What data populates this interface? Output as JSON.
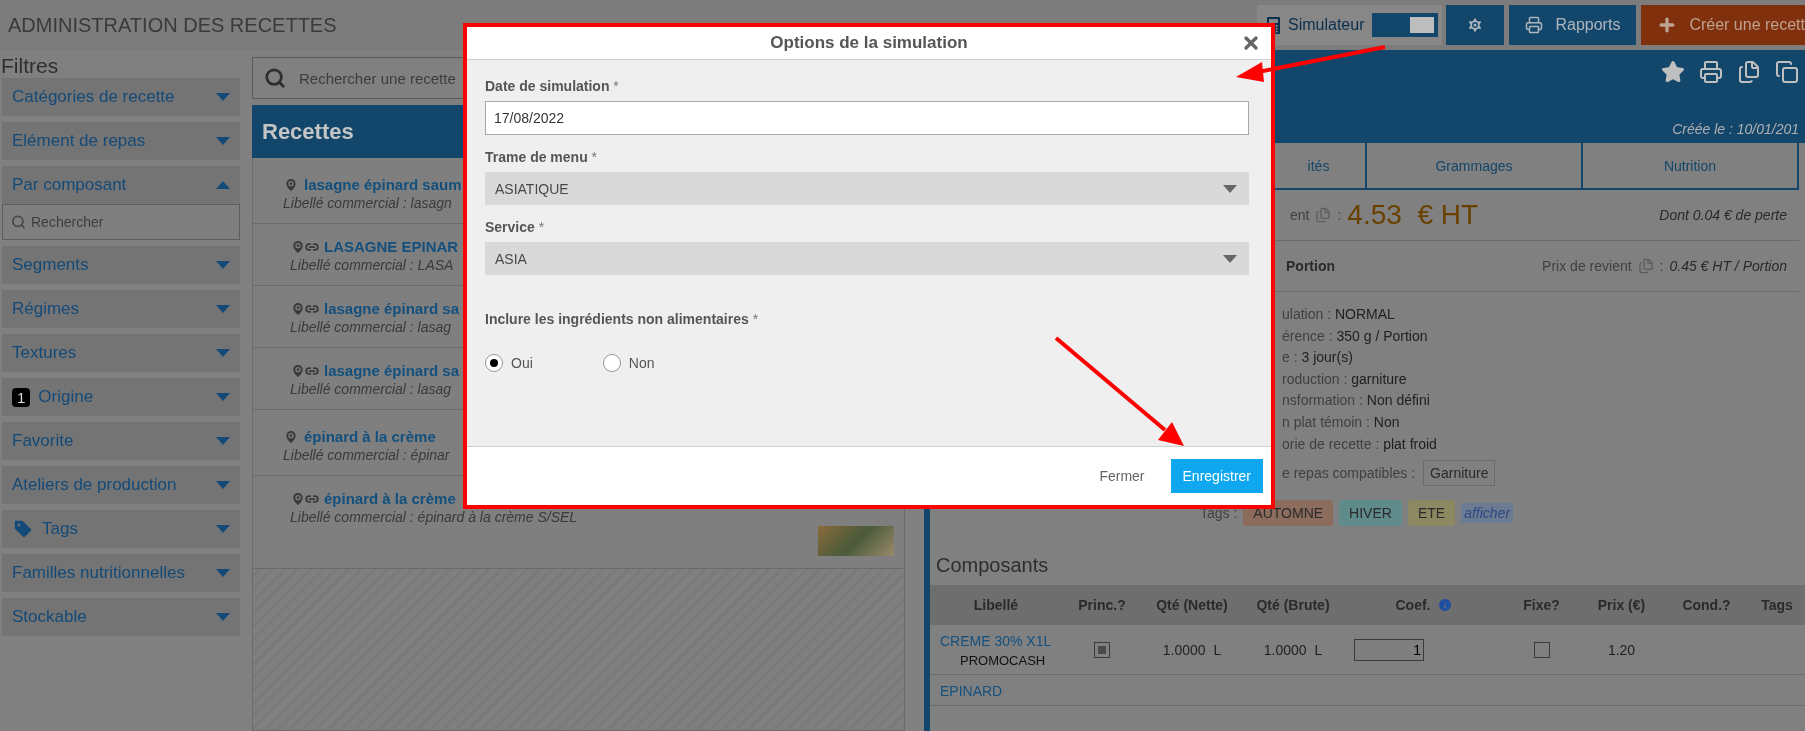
{
  "header": {
    "title": "ADMINISTRATION DES RECETTES",
    "simulator": {
      "label": "Simulateur",
      "on": true
    },
    "buttons": [
      {
        "kind": "settings"
      },
      {
        "kind": "reports",
        "label": "Rapports"
      },
      {
        "kind": "create",
        "label": "Créer une recett"
      }
    ]
  },
  "filters": {
    "title": "Filtres",
    "items": [
      {
        "kind": "plain",
        "label": "Catégories de recette",
        "expanded": false
      },
      {
        "kind": "plain",
        "label": "Elément de repas",
        "expanded": false
      },
      {
        "kind": "plain",
        "label": "Par composant",
        "expanded": true,
        "search_placeholder": "Rechercher"
      },
      {
        "kind": "plain",
        "label": "Segments",
        "expanded": false
      },
      {
        "kind": "plain",
        "label": "Régimes",
        "expanded": false
      },
      {
        "kind": "plain",
        "label": "Textures",
        "expanded": false
      },
      {
        "kind": "badge",
        "label": "Origine",
        "badge": "1",
        "expanded": false
      },
      {
        "kind": "plain",
        "label": "Favorite",
        "expanded": false
      },
      {
        "kind": "plain",
        "label": "Ateliers de production",
        "expanded": false
      },
      {
        "kind": "tag",
        "label": "Tags",
        "expanded": false
      },
      {
        "kind": "plain",
        "label": "Familles nutritionnelles",
        "expanded": false
      },
      {
        "kind": "plain",
        "label": "Stockable",
        "expanded": false
      }
    ]
  },
  "recipes": {
    "search_placeholder": "Rechercher une recette",
    "title": "Recettes",
    "items": [
      {
        "kind": "single",
        "name": "lasagne épinard saum",
        "subtitle": "Libellé commercial : lasagn",
        "photo": false
      },
      {
        "kind": "linked",
        "name": "LASAGNE EPINAR",
        "subtitle": "Libellé commercial : LASA",
        "photo": false
      },
      {
        "kind": "linked",
        "name": "lasagne épinard sa",
        "subtitle": "Libellé commercial : lasag",
        "photo": false
      },
      {
        "kind": "linked",
        "name": "lasagne épinard sa",
        "subtitle": "Libellé commercial : lasag",
        "photo": false
      },
      {
        "kind": "single",
        "name": "épinard à la crème",
        "subtitle": "Libellé commercial : épinar",
        "photo": false
      },
      {
        "kind": "linked",
        "name": "épinard à la crème",
        "subtitle": "Libellé commercial : épinard à la crème S/SEL",
        "photo": true
      }
    ]
  },
  "detail": {
    "created": "Créée le : 10/01/201",
    "tabs": [
      {
        "label": "ités",
        "selected": false
      },
      {
        "label": "Grammages",
        "selected": false
      },
      {
        "label": "Nutrition",
        "selected": false
      }
    ],
    "cost": {
      "label": "ent",
      "separator": ":",
      "value": "4.53  € HT",
      "loss": "Dont 0.04 € de perte"
    },
    "portion": {
      "title": "Portion",
      "label": "Prix de revient",
      "separator": ":",
      "value": "0.45 € HT / Portion"
    },
    "properties": [
      {
        "label": "ulation :",
        "value": "NORMAL"
      },
      {
        "label": "érence :",
        "value": "350 g / Portion"
      },
      {
        "label": "e :",
        "value": "3 jour(s)"
      },
      {
        "label": "roduction :",
        "value": "garniture"
      },
      {
        "label": "nsformation :",
        "value": "Non défini"
      },
      {
        "label": "n plat témoin :",
        "value": "Non"
      },
      {
        "label": "orie de recette :",
        "value": "plat froid"
      }
    ],
    "compatible": {
      "label": "e repas compatibles :",
      "value": "Garniture"
    },
    "tags": {
      "label": "Tags :",
      "items": [
        {
          "label": "AUTOMNE",
          "color": "#8c6c5c"
        },
        {
          "label": "HIVER",
          "color": "#5f8b8b"
        },
        {
          "label": "ETE",
          "color": "#8c8862"
        }
      ],
      "more": "afficher"
    },
    "components": {
      "title": "Composants",
      "columns": [
        {
          "label": "Libellé",
          "info": false
        },
        {
          "label": "Princ.?",
          "info": false
        },
        {
          "label": "Qté (Nette)",
          "info": false
        },
        {
          "label": "Qté (Brute)",
          "info": false
        },
        {
          "label": "Coef.",
          "info": true
        },
        {
          "label": "Fixe?",
          "info": false
        },
        {
          "label": "Prix (€)",
          "info": false
        },
        {
          "label": "Cond.?",
          "info": false
        },
        {
          "label": "Tags",
          "info": false
        }
      ],
      "rows": [
        {
          "name": "CREME 30% X1L",
          "supplier": "PROMOCASH",
          "main": true,
          "net": "1.0000  L",
          "gross": "1.0000  L",
          "coef": "1",
          "fixed": false,
          "price": "1.20"
        },
        {
          "name": "EPINARD"
        }
      ]
    }
  },
  "dialog": {
    "title": "Options de la simulation",
    "fields": [
      {
        "kind": "date",
        "label": "Date de simulation",
        "required": "*",
        "value": "17/08/2022"
      },
      {
        "kind": "select",
        "label": "Trame de menu",
        "required": "*",
        "value": "ASIATIQUE"
      },
      {
        "kind": "select",
        "label": "Service",
        "required": "*",
        "value": "ASIA"
      }
    ],
    "include": {
      "label": "Inclure les ingrédients non alimentaires",
      "required": "*",
      "options": [
        {
          "label": "Oui",
          "selected": true
        },
        {
          "label": "Non",
          "selected": false
        }
      ]
    },
    "buttons": [
      {
        "kind": "link",
        "label": "Fermer"
      },
      {
        "kind": "primary",
        "label": "Enregistrer"
      }
    ]
  }
}
